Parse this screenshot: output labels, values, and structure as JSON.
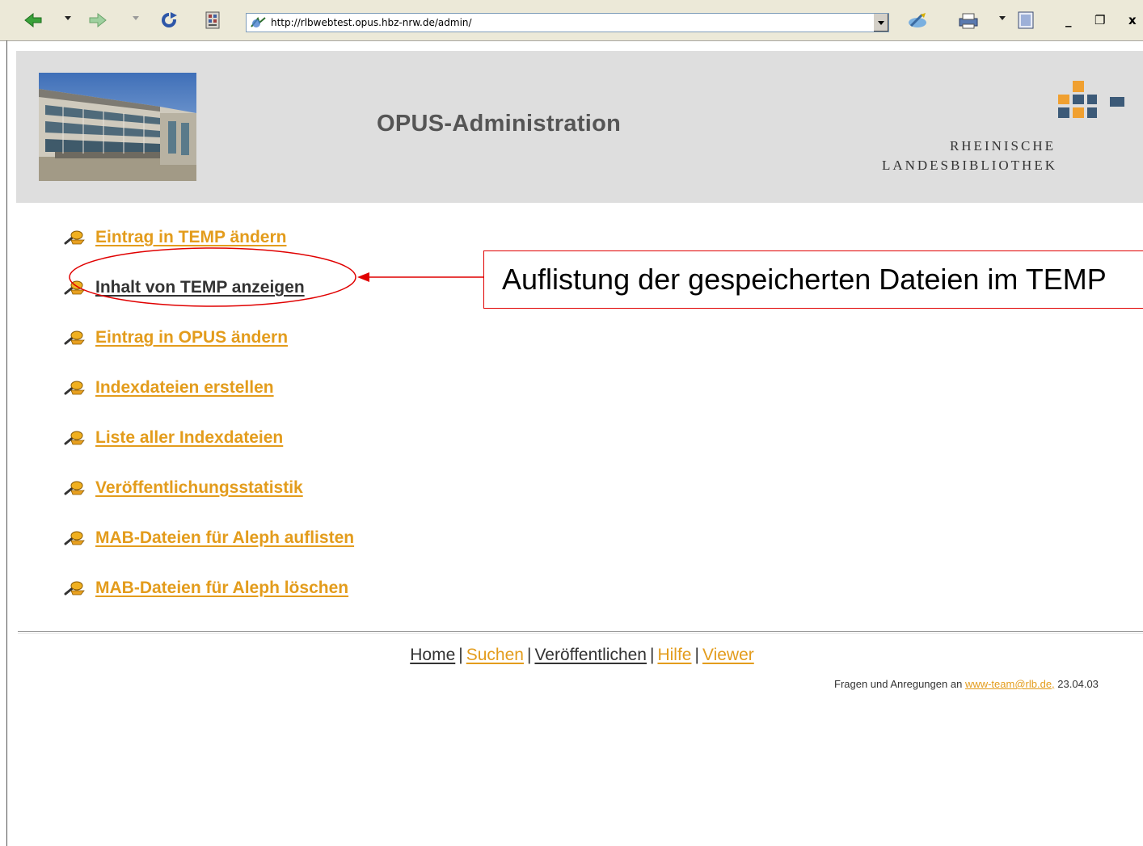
{
  "browser": {
    "url": "http://rlbwebtest.opus.hbz-nrw.de/admin/",
    "window_controls": [
      "_",
      "❐",
      "x"
    ]
  },
  "header": {
    "title": "OPUS-Administration",
    "logo_line1": "RHEINISCHE",
    "logo_line2": "LANDESBIBLIOTHEK"
  },
  "menu": {
    "items": [
      {
        "label": "Eintrag in TEMP ändern"
      },
      {
        "label": "Inhalt von TEMP anzeigen"
      },
      {
        "label": "Eintrag in OPUS ändern"
      },
      {
        "label": "Indexdateien erstellen"
      },
      {
        "label": "Liste aller Indexdateien"
      },
      {
        "label": "Veröffentlichungsstatistik"
      },
      {
        "label": "MAB-Dateien für Aleph auflisten"
      },
      {
        "label": "MAB-Dateien für Aleph löschen"
      }
    ]
  },
  "annotation": {
    "text": "Auflistung der gespeicherten Dateien im TEMP"
  },
  "footer": {
    "links": [
      "Home",
      "Suchen",
      "Veröffentlichen",
      "Hilfe",
      "Viewer"
    ],
    "separator": "|",
    "contact_prefix": "Fragen und Anregungen an",
    "contact_email": "www-team@rlb.de,",
    "contact_date": "23.04.03"
  },
  "colors": {
    "link": "#e39c1c",
    "visited_link": "#333333",
    "header_bg": "#dedede",
    "annotation": "#e00000",
    "logo_orange": "#f0a030",
    "logo_blue": "#3c5a78"
  }
}
